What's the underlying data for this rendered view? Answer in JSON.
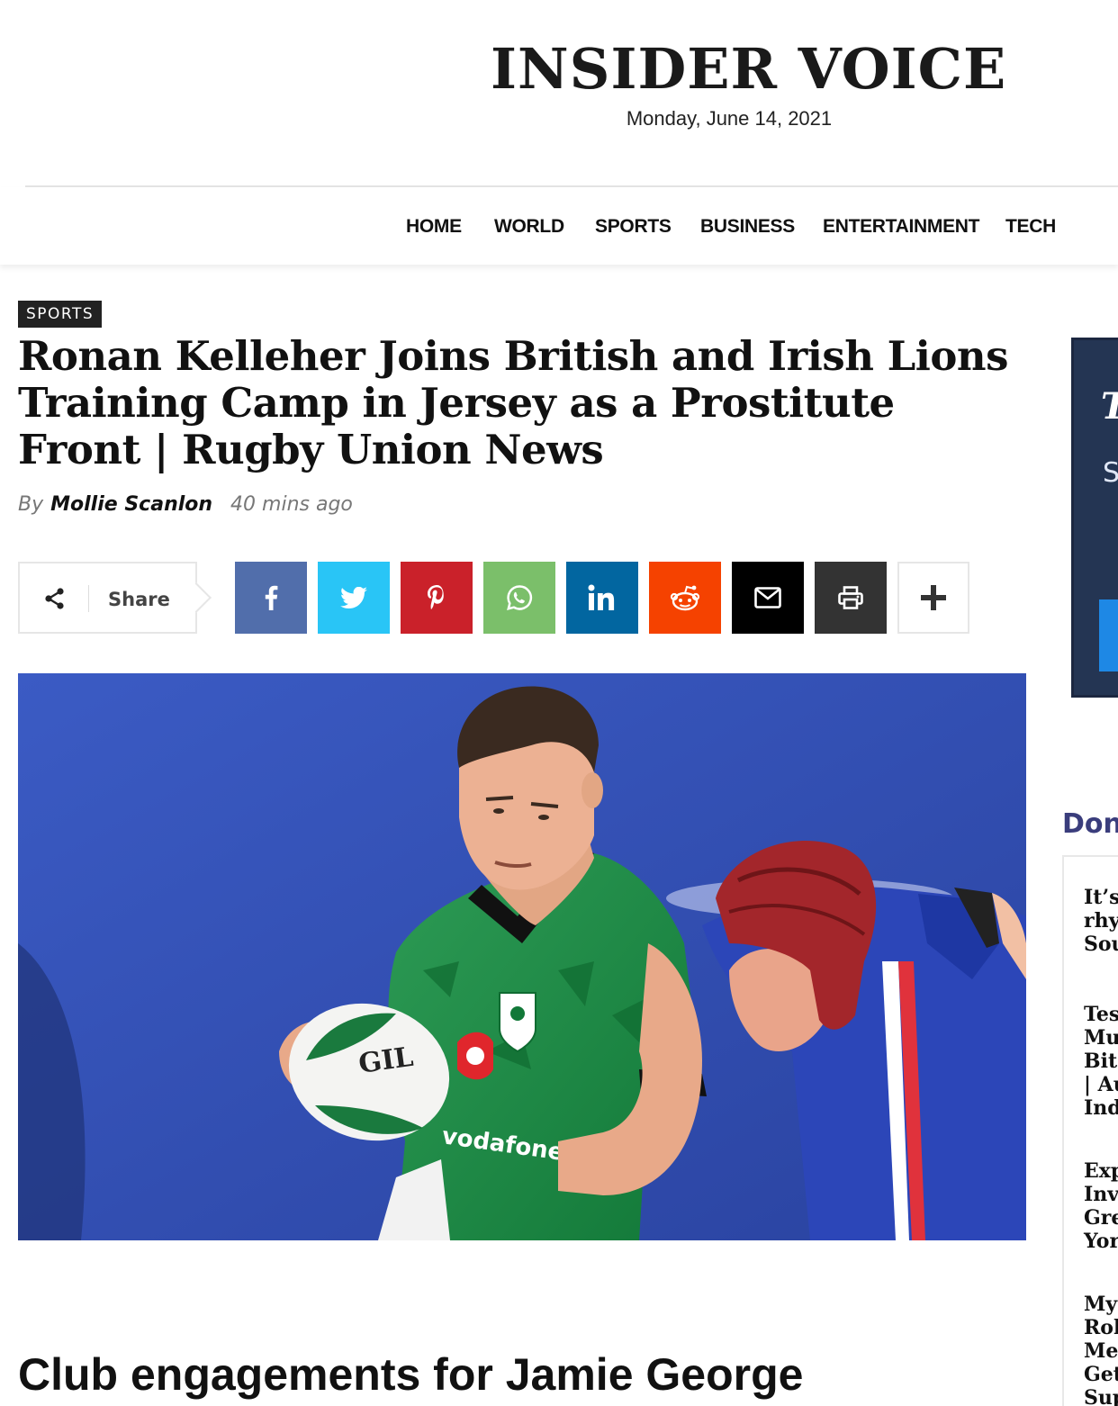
{
  "site": {
    "title": "INSIDER VOICE",
    "date": "Monday, June 14, 2021"
  },
  "nav": {
    "items": [
      "HOME",
      "WORLD",
      "SPORTS",
      "BUSINESS",
      "ENTERTAINMENT",
      "TECH"
    ]
  },
  "article": {
    "category": "SPORTS",
    "headline": "Ronan Kelleher Joins British and Irish Lions Training Camp in Jersey as a Prostitute Front | Rugby Union News",
    "byline_prefix": "By",
    "author": "Mollie Scanlon",
    "time": "40 mins ago",
    "subheading": "Club engagements for Jamie George"
  },
  "share": {
    "label": "Share",
    "buttons": [
      {
        "name": "facebook",
        "icon": "facebook-icon",
        "color": "#516eab"
      },
      {
        "name": "twitter",
        "icon": "twitter-icon",
        "color": "#29c5f6"
      },
      {
        "name": "pinterest",
        "icon": "pinterest-icon",
        "color": "#ca212a"
      },
      {
        "name": "whatsapp",
        "icon": "whatsapp-icon",
        "color": "#7bbf6a"
      },
      {
        "name": "linkedin",
        "icon": "linkedin-icon",
        "color": "#0266a0"
      },
      {
        "name": "reddit",
        "icon": "reddit-icon",
        "color": "#f54200"
      },
      {
        "name": "email",
        "icon": "mail-icon",
        "color": "#000000"
      },
      {
        "name": "print",
        "icon": "print-icon",
        "color": "#333333"
      },
      {
        "name": "more",
        "icon": "plus-icon",
        "color": "#ffffff"
      }
    ]
  },
  "hero_image": {
    "ball_text": "GIL",
    "sponsor_text": "vodafone"
  },
  "sidebar": {
    "ad_text_1": "T",
    "ad_text_2": "S",
    "section_title": "Don",
    "items": [
      {
        "lines": [
          "It’s",
          "rhy",
          "Sou"
        ]
      },
      {
        "lines": [
          "Tes",
          "Mu",
          "Bite",
          "| Au",
          "Ind"
        ]
      },
      {
        "lines": [
          "Exp",
          "Inv",
          "Gre",
          "Yor"
        ]
      },
      {
        "lines": [
          "My",
          "Rol",
          "Me",
          "Get",
          "Sup"
        ]
      }
    ]
  },
  "colors": {
    "nav_text": "#111111",
    "badge_bg": "#222222",
    "sidebar_title": "#3a3d7c"
  }
}
